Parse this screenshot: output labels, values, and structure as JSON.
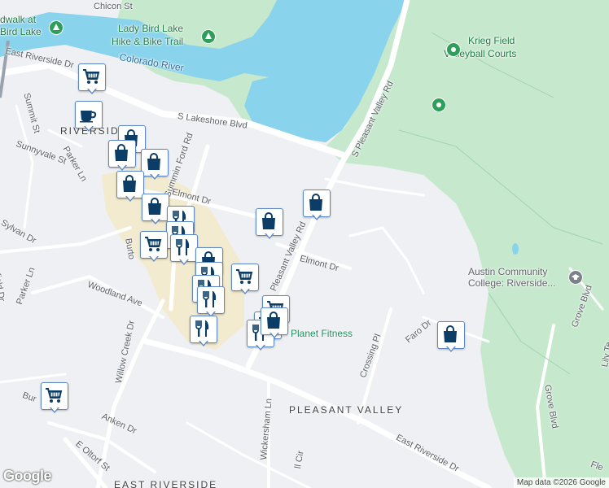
{
  "map": {
    "colors": {
      "land": "#eef0f3",
      "water": "#8ad3ec",
      "park": "#c6e9cd",
      "commercial": "#f3ebcf",
      "road": "#ffffff",
      "marker_border": "#5c88c6",
      "marker_icon": "#0b3d66",
      "poi_green": "#2e9e5b"
    },
    "labels": {
      "boardwalk_1": "dwalk at",
      "boardwalk_2": "Bird Lake",
      "hike_bike_1": "Lady Bird Lake",
      "hike_bike_2": "Hike & Bike Trail",
      "colorado_river": "Colorado River",
      "chicon": "Chicon St",
      "krieg_1": "Krieg Field",
      "krieg_2": "Volleyball Courts",
      "east_riverside_top": "East Riverside Dr",
      "summit": "Summit St",
      "riverside_area": "RIVERSID",
      "sunnyvale": "Sunnyvale St",
      "parker_top": "Parker Ln",
      "lakeshore": "S Lakeshore Blvd",
      "pleasant_valley_n": "S Pleasant Valley Rd",
      "montford": "Summin Ford Rd",
      "elmont_w": "Elmont Dr",
      "sylvan": "Sylvan Dr",
      "parker_w": "Parker Ln",
      "field_dr": "field Dr",
      "woodland": "Woodland Ave",
      "burton": "Burto",
      "pleasant_valley_s": "Pleasant Valley Rd",
      "elmont_e": "Elmont Dr",
      "acc_1": "Austin Community",
      "acc_2": "College: Riverside...",
      "willow_creek": "Willow Creek Dr",
      "planet_fitness": "Planet Fitness",
      "faro": "Faro Dr",
      "crossing_pl": "Crossing Pl",
      "grove_blvd_r": "Grove Blvd",
      "grove_blvd": "Grove Blvd",
      "lily": "Lily Te",
      "burl": "Bur",
      "anken": "Anken Dr",
      "wickersham": "Wickersham Ln",
      "pleasant_valley_area": "PLEASANT VALLEY",
      "e_oltorf": "E Oltorf St",
      "east_riverside_bottom": "East Riverside Dr",
      "east_riverside_area": "EAST RIVERSIDE",
      "all_cir": "ll Cir",
      "fle": "Fle"
    },
    "markers": [
      {
        "icon": "shopping-cart-icon"
      },
      {
        "icon": "coffee-cup-icon"
      },
      {
        "icon": "shopping-bag-icon"
      },
      {
        "icon": "shopping-bag-icon"
      },
      {
        "icon": "shopping-bag-icon"
      },
      {
        "icon": "shopping-bag-icon"
      },
      {
        "icon": "shopping-bag-icon"
      },
      {
        "icon": "shopping-bag-icon"
      },
      {
        "icon": "fork-knife-icon"
      },
      {
        "icon": "fork-knife-icon"
      },
      {
        "icon": "shopping-cart-icon"
      },
      {
        "icon": "fork-knife-icon"
      },
      {
        "icon": "shopping-bag-icon"
      },
      {
        "icon": "fork-knife-icon"
      },
      {
        "icon": "shopping-cart-icon"
      },
      {
        "icon": "fork-knife-icon"
      },
      {
        "icon": "fork-knife-icon"
      },
      {
        "icon": "shopping-bag-icon"
      },
      {
        "icon": "shopping-bag-icon"
      },
      {
        "icon": "shopping-cart-icon"
      },
      {
        "icon": "shopping-cart-icon"
      },
      {
        "icon": "fork-knife-icon"
      },
      {
        "icon": "fork-knife-icon"
      },
      {
        "icon": "shopping-bag-icon"
      },
      {
        "icon": "shopping-cart-icon"
      }
    ],
    "attribution": "Map data ©2026 Google",
    "logo": "Google"
  }
}
